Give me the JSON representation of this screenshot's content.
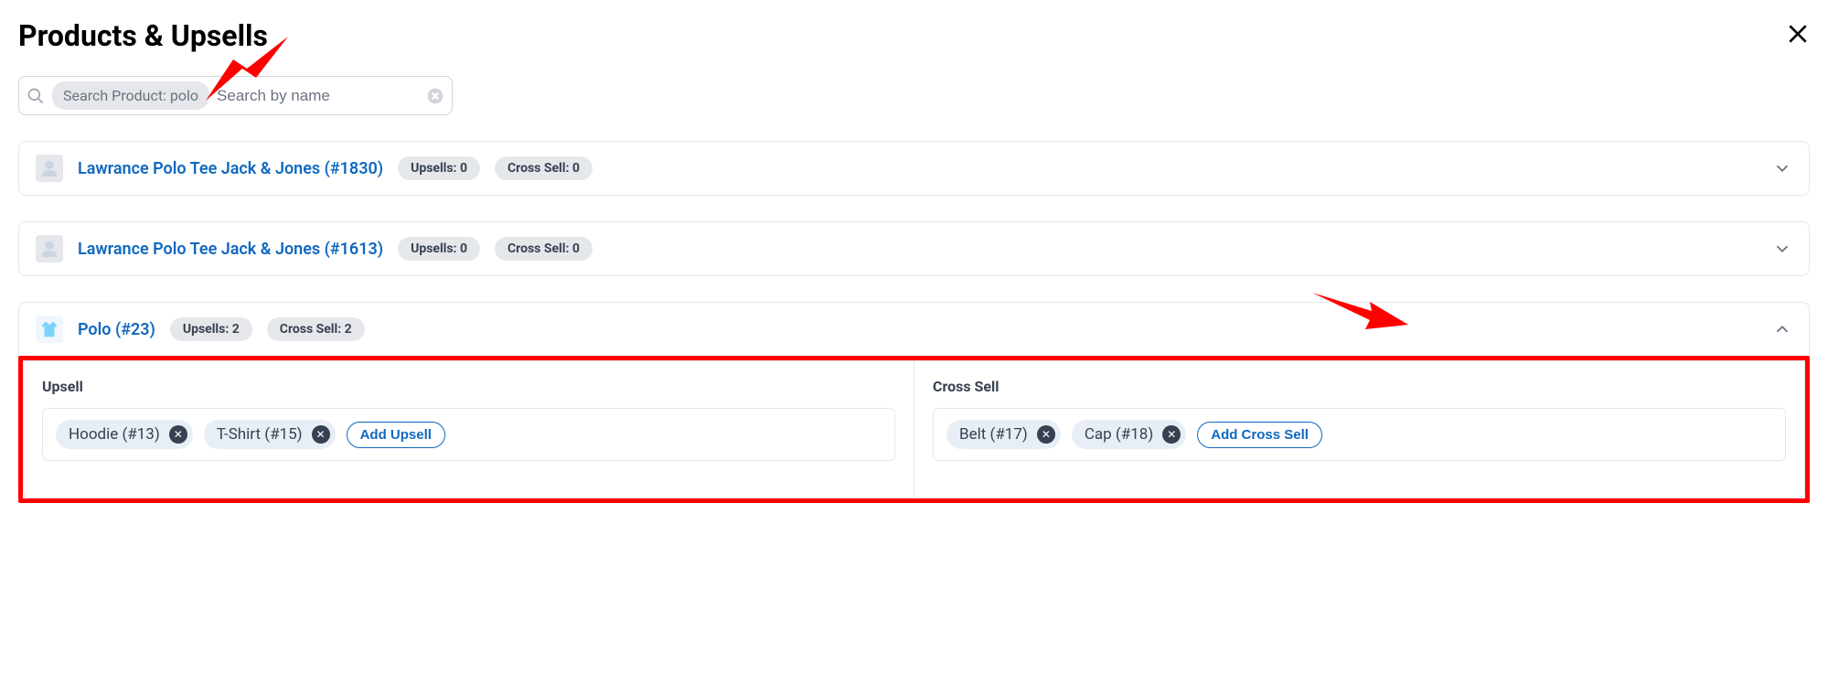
{
  "header": {
    "title": "Products & Upsells"
  },
  "search": {
    "chip_label": "Search Product: polo",
    "placeholder": "Search by name"
  },
  "products": [
    {
      "name": "Lawrance Polo Tee Jack & Jones (#1830)",
      "upsell_badge": "Upsells: 0",
      "cross_badge": "Cross Sell: 0",
      "expanded": false
    },
    {
      "name": "Lawrance Polo Tee Jack & Jones (#1613)",
      "upsell_badge": "Upsells: 0",
      "cross_badge": "Cross Sell: 0",
      "expanded": false
    },
    {
      "name": "Polo (#23)",
      "upsell_badge": "Upsells: 2",
      "cross_badge": "Cross Sell: 2",
      "expanded": true
    }
  ],
  "panel": {
    "upsell_label": "Upsell",
    "cross_label": "Cross Sell",
    "upsell_items": [
      {
        "label": "Hoodie (#13)"
      },
      {
        "label": "T-Shirt (#15)"
      }
    ],
    "cross_items": [
      {
        "label": "Belt (#17)"
      },
      {
        "label": "Cap (#18)"
      }
    ],
    "add_upsell_label": "Add Upsell",
    "add_cross_label": "Add Cross Sell"
  }
}
